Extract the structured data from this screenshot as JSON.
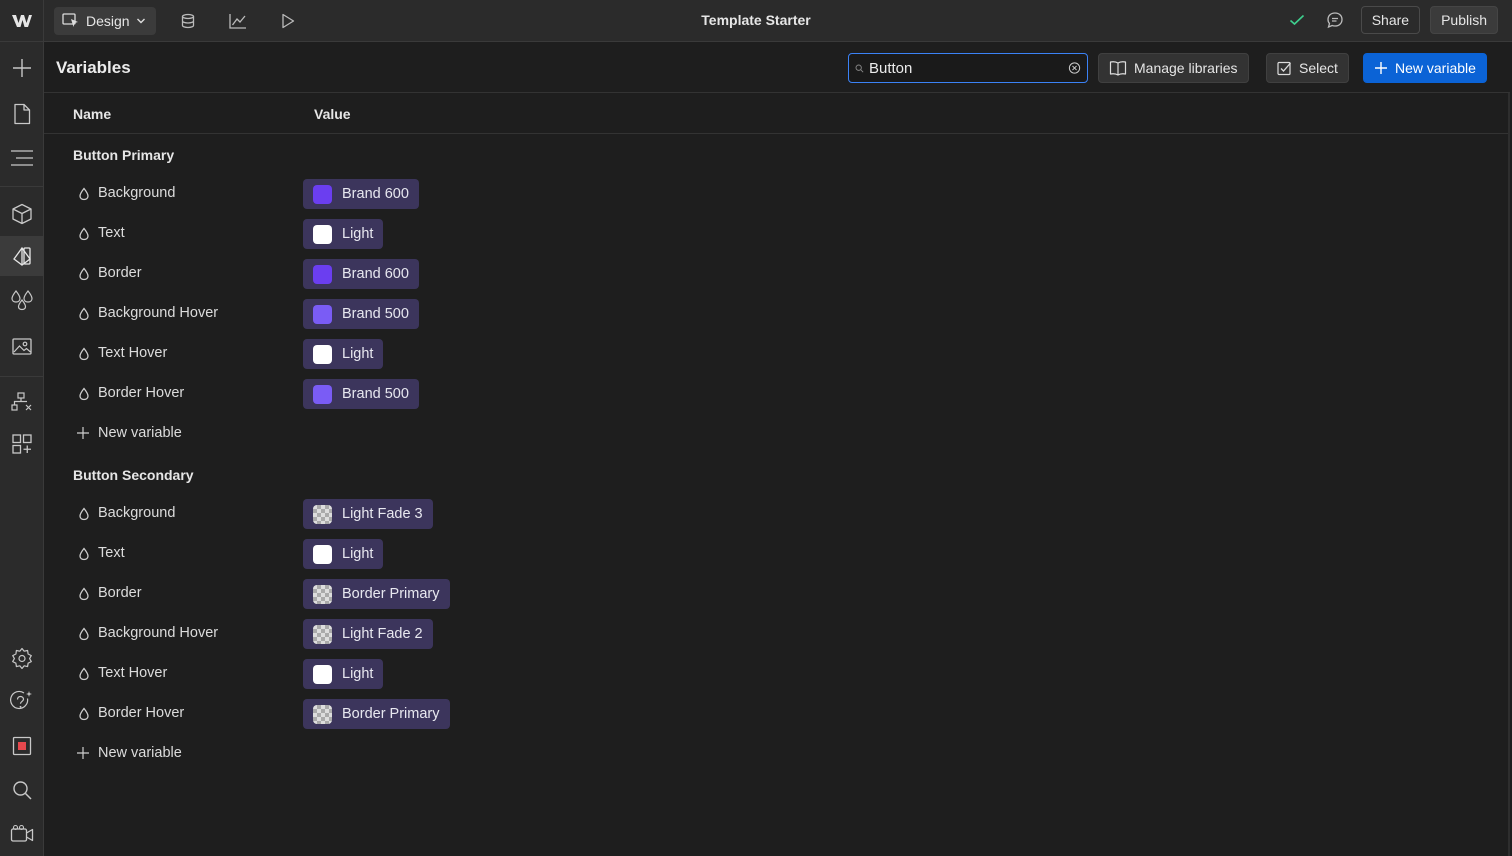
{
  "topbar": {
    "mode_label": "Design",
    "title": "Template Starter",
    "share_label": "Share",
    "publish_label": "Publish",
    "icons": [
      "webflow-logo",
      "cursor-icon",
      "database-icon",
      "chart-icon",
      "play-icon",
      "check-icon",
      "comment-icon"
    ]
  },
  "sidebar": {
    "icons": [
      "add-icon",
      "page-icon",
      "navigator-icon",
      "components-icon",
      "variables-icon",
      "styles-icon",
      "assets-icon",
      "logic-icon",
      "apps-icon",
      "settings-icon",
      "help-icon",
      "record-icon",
      "search-icon",
      "video-icon"
    ],
    "active": "variables-icon"
  },
  "panel": {
    "title": "Variables",
    "search": {
      "value": "Button",
      "placeholder": ""
    },
    "manage_libraries_label": "Manage libraries",
    "select_label": "Select",
    "new_variable_label": "New variable",
    "columns": {
      "name": "Name",
      "value": "Value"
    }
  },
  "groups": [
    {
      "title": "Button Primary",
      "rows": [
        {
          "name": "Background",
          "value": "Brand 600",
          "swatch": "#6b3ef0"
        },
        {
          "name": "Text",
          "value": "Light",
          "swatch": "#ffffff"
        },
        {
          "name": "Border",
          "value": "Brand 600",
          "swatch": "#6b3ef0"
        },
        {
          "name": "Background Hover",
          "value": "Brand 500",
          "swatch": "#7a5cf5"
        },
        {
          "name": "Text Hover",
          "value": "Light",
          "swatch": "#ffffff"
        },
        {
          "name": "Border Hover",
          "value": "Brand 500",
          "swatch": "#7a5cf5"
        }
      ],
      "new_label": "New variable"
    },
    {
      "title": "Button Secondary",
      "rows": [
        {
          "name": "Background",
          "value": "Light Fade 3",
          "swatch": "checker"
        },
        {
          "name": "Text",
          "value": "Light",
          "swatch": "#ffffff"
        },
        {
          "name": "Border",
          "value": "Border Primary",
          "swatch": "checker"
        },
        {
          "name": "Background Hover",
          "value": "Light Fade 2",
          "swatch": "checker"
        },
        {
          "name": "Text Hover",
          "value": "Light",
          "swatch": "#ffffff"
        },
        {
          "name": "Border Hover",
          "value": "Border Primary",
          "swatch": "checker"
        }
      ],
      "new_label": "New variable"
    }
  ]
}
